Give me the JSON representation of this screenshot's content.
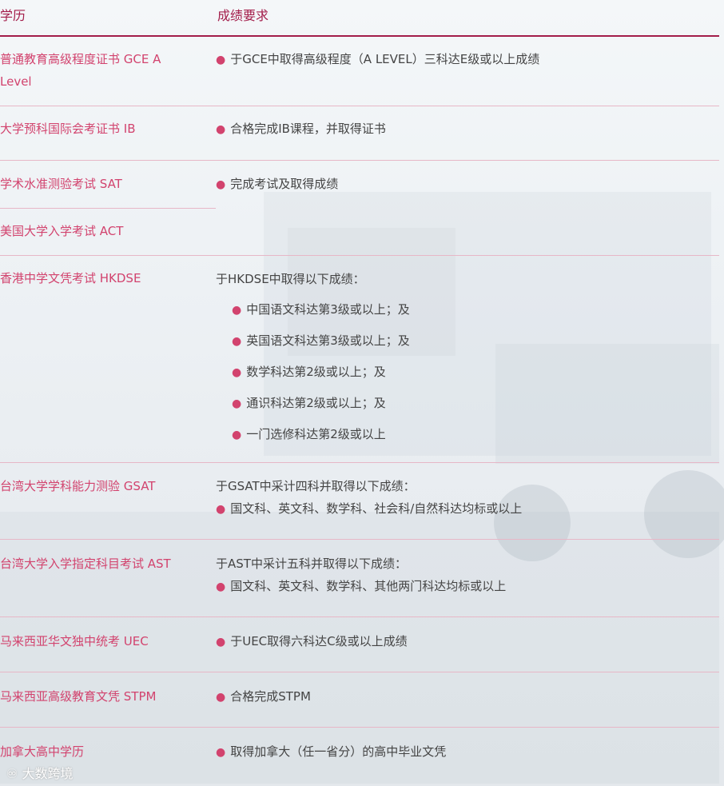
{
  "header": {
    "col1": "学历",
    "col2": "成绩要求"
  },
  "rows": [
    {
      "qual": "普通教育高级程度证书 GCE A Level",
      "req": [
        "于GCE中取得高级程度（A LEVEL）三科达E级或以上成绩"
      ]
    },
    {
      "qual": "大学预科国际会考证书 IB",
      "req": [
        "合格完成IB课程，并取得证书"
      ]
    },
    {
      "qual": "学术水准测验考试 SAT",
      "req": [
        "完成考试及取得成绩"
      ]
    },
    {
      "qual": "美国大学入学考试 ACT"
    },
    {
      "qual": "香港中学文凭考试 HKDSE",
      "intro": "于HKDSE中取得以下成绩：",
      "req": [
        "中国语文科达第3级或以上；及",
        "英国语文科达第3级或以上；及",
        "数学科达第2级或以上；及",
        "通识科达第2级或以上；及",
        "一门选修科达第2级或以上"
      ]
    },
    {
      "qual": "台湾大学学科能力测验 GSAT",
      "intro": "于GSAT中采计四科并取得以下成绩：",
      "req": [
        "国文科、英文科、数学科、社会科/自然科达均标或以上"
      ]
    },
    {
      "qual": "台湾大学入学指定科目考试 AST",
      "intro": "于AST中采计五科并取得以下成绩：",
      "req": [
        "国文科、英文科、数学科、其他两门科达均标或以上"
      ]
    },
    {
      "qual": "马来西亚华文独中统考 UEC",
      "req": [
        "于UEC取得六科达C级或以上成绩"
      ]
    },
    {
      "qual": "马来西亚高级教育文凭 STPM",
      "req": [
        "合格完成STPM"
      ]
    },
    {
      "qual": "加拿大高中学历",
      "req": [
        "取得加拿大（任一省分）的高中毕业文凭"
      ]
    }
  ],
  "watermark": "大数跨境",
  "colors": {
    "accent": "#a31d4a",
    "qual_text": "#d2436e"
  }
}
